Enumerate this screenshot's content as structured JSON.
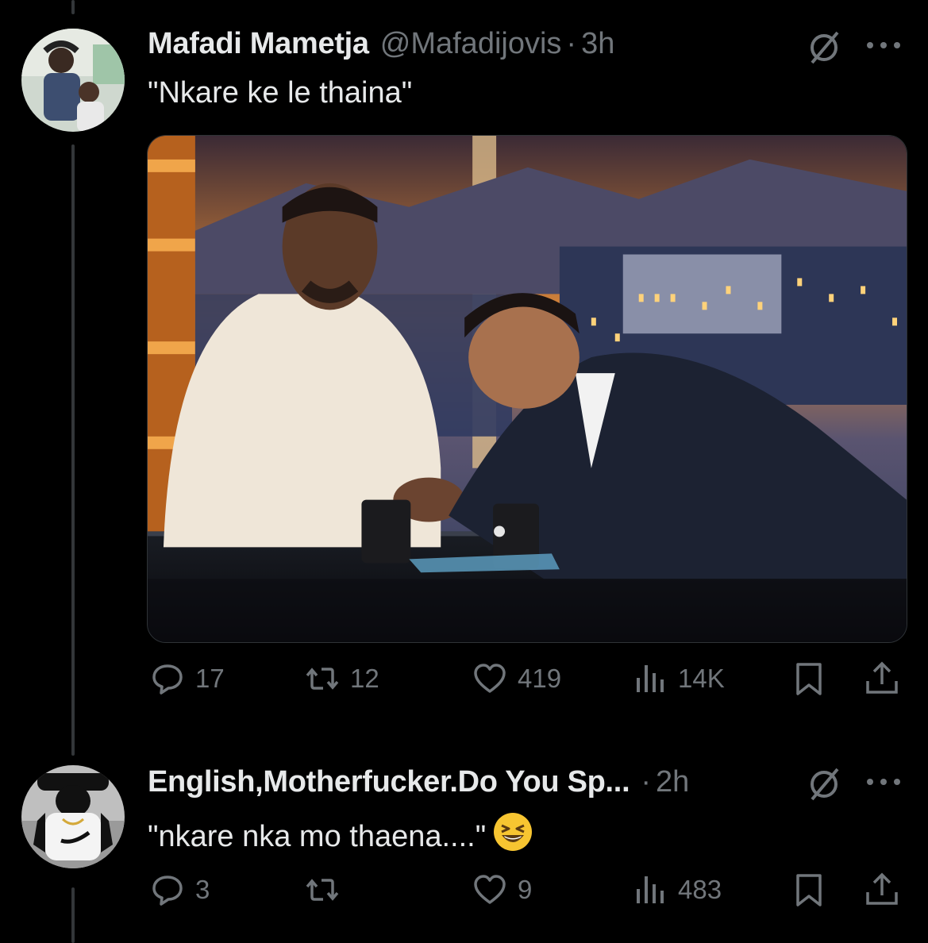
{
  "tweets": [
    {
      "author_name": "Mafadi Mametja",
      "handle": "@Mafadijovis",
      "separator": "·",
      "time": "3h",
      "text": "\"Nkare ke le thaina\"",
      "media_icon": "photo",
      "stats": {
        "replies": "17",
        "retweets": "12",
        "likes": "419",
        "views": "14K"
      }
    },
    {
      "author_name": "English,Motherfucker.Do You Sp...",
      "separator": "·",
      "time": "2h",
      "text": "\"nkare nka mo thaena....\"",
      "emoji": "grinning-squinting-face",
      "stats": {
        "replies": "3",
        "retweets": "",
        "likes": "9",
        "views": "483"
      }
    }
  ],
  "icons": {
    "reply": "reply-icon",
    "retweet": "retweet-icon",
    "like": "heart-icon",
    "views": "views-icon",
    "bookmark": "bookmark-icon",
    "share": "share-icon",
    "grok": "grok-icon",
    "more": "more-icon"
  },
  "colors": {
    "background": "#000000",
    "text": "#e7e9ea",
    "muted": "#71767b",
    "line": "#333639"
  }
}
